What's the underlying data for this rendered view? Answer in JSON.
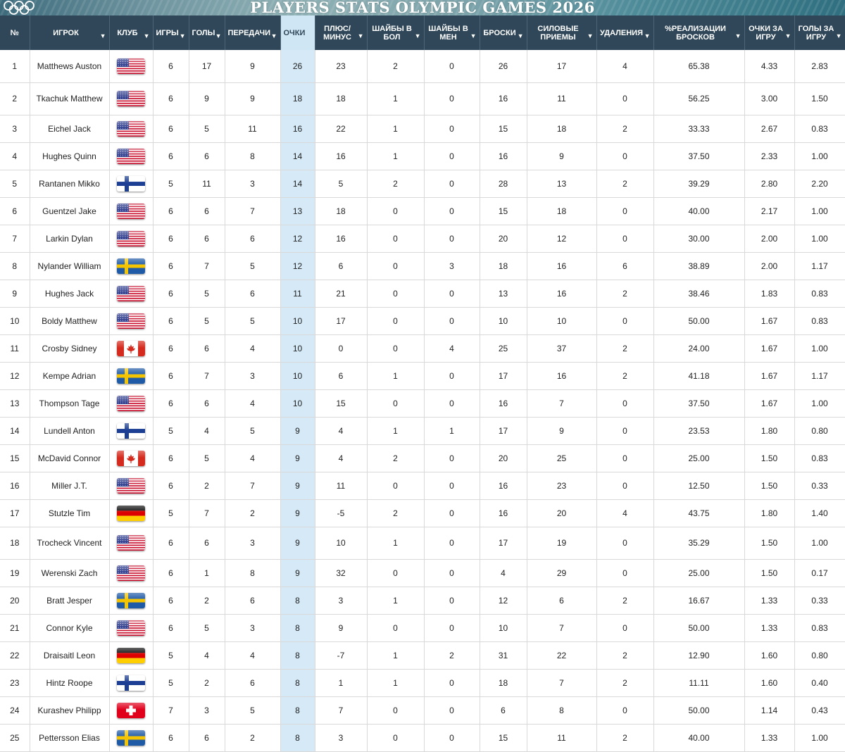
{
  "page": {
    "title": "PLAYERS STATS OLYMPIC GAMES 2026"
  },
  "colors": {
    "header_bg": "#2f4758",
    "highlight_col": "#d5e9f7",
    "highlight_header": "#cfe6f5"
  },
  "columns": [
    {
      "key": "num",
      "label": "№",
      "sortable": false
    },
    {
      "key": "player",
      "label": "ИГРОК",
      "sortable": true
    },
    {
      "key": "club",
      "label": "КЛУБ",
      "sortable": true
    },
    {
      "key": "games",
      "label": "ИГРЫ",
      "sortable": true
    },
    {
      "key": "goals",
      "label": "ГОЛЫ",
      "sortable": true
    },
    {
      "key": "assists",
      "label": "ПЕРЕДАЧИ",
      "sortable": true
    },
    {
      "key": "points",
      "label": "ОЧКИ",
      "sortable": true
    },
    {
      "key": "plusminus",
      "label": "ПЛЮС/ МИНУС",
      "sortable": true
    },
    {
      "key": "ppg",
      "label": "ШАЙБЫ В БОЛ",
      "sortable": true
    },
    {
      "key": "shg",
      "label": "ШАЙБЫ В МЕН",
      "sortable": true
    },
    {
      "key": "shots",
      "label": "БРОСКИ",
      "sortable": true
    },
    {
      "key": "hits",
      "label": "СИЛОВЫЕ ПРИЕМЫ",
      "sortable": true
    },
    {
      "key": "pim",
      "label": "УДАЛЕНИЯ",
      "sortable": true
    },
    {
      "key": "shot_pct",
      "label": "%РЕАЛИЗАЦИИ БРОСКОВ",
      "sortable": true
    },
    {
      "key": "ppg_avg",
      "label": "ОЧКИ ЗА ИГРУ",
      "sortable": true
    },
    {
      "key": "gpg_avg",
      "label": "ГОЛЫ ЗА ИГРУ",
      "sortable": true
    }
  ],
  "rows": [
    {
      "num": "1",
      "player": "Matthews Auston",
      "flag": "usa",
      "games": "6",
      "goals": "17",
      "assists": "9",
      "points": "26",
      "plusminus": "23",
      "ppg": "2",
      "shg": "0",
      "shots": "26",
      "hits": "17",
      "pim": "4",
      "shot_pct": "65.38",
      "ppg_avg": "4.33",
      "gpg_avg": "2.83"
    },
    {
      "num": "2",
      "player": "Tkachuk Matthew",
      "flag": "usa",
      "games": "6",
      "goals": "9",
      "assists": "9",
      "points": "18",
      "plusminus": "18",
      "ppg": "1",
      "shg": "0",
      "shots": "16",
      "hits": "11",
      "pim": "0",
      "shot_pct": "56.25",
      "ppg_avg": "3.00",
      "gpg_avg": "1.50"
    },
    {
      "num": "3",
      "player": "Eichel Jack",
      "flag": "usa",
      "games": "6",
      "goals": "5",
      "assists": "11",
      "points": "16",
      "plusminus": "22",
      "ppg": "1",
      "shg": "0",
      "shots": "15",
      "hits": "18",
      "pim": "2",
      "shot_pct": "33.33",
      "ppg_avg": "2.67",
      "gpg_avg": "0.83"
    },
    {
      "num": "4",
      "player": "Hughes Quinn",
      "flag": "usa",
      "games": "6",
      "goals": "6",
      "assists": "8",
      "points": "14",
      "plusminus": "16",
      "ppg": "1",
      "shg": "0",
      "shots": "16",
      "hits": "9",
      "pim": "0",
      "shot_pct": "37.50",
      "ppg_avg": "2.33",
      "gpg_avg": "1.00"
    },
    {
      "num": "5",
      "player": "Rantanen Mikko",
      "flag": "fin",
      "games": "5",
      "goals": "11",
      "assists": "3",
      "points": "14",
      "plusminus": "5",
      "ppg": "2",
      "shg": "0",
      "shots": "28",
      "hits": "13",
      "pim": "2",
      "shot_pct": "39.29",
      "ppg_avg": "2.80",
      "gpg_avg": "2.20"
    },
    {
      "num": "6",
      "player": "Guentzel Jake",
      "flag": "usa",
      "games": "6",
      "goals": "6",
      "assists": "7",
      "points": "13",
      "plusminus": "18",
      "ppg": "0",
      "shg": "0",
      "shots": "15",
      "hits": "18",
      "pim": "0",
      "shot_pct": "40.00",
      "ppg_avg": "2.17",
      "gpg_avg": "1.00"
    },
    {
      "num": "7",
      "player": "Larkin Dylan",
      "flag": "usa",
      "games": "6",
      "goals": "6",
      "assists": "6",
      "points": "12",
      "plusminus": "16",
      "ppg": "0",
      "shg": "0",
      "shots": "20",
      "hits": "12",
      "pim": "0",
      "shot_pct": "30.00",
      "ppg_avg": "2.00",
      "gpg_avg": "1.00"
    },
    {
      "num": "8",
      "player": "Nylander William",
      "flag": "swe",
      "games": "6",
      "goals": "7",
      "assists": "5",
      "points": "12",
      "plusminus": "6",
      "ppg": "0",
      "shg": "3",
      "shots": "18",
      "hits": "16",
      "pim": "6",
      "shot_pct": "38.89",
      "ppg_avg": "2.00",
      "gpg_avg": "1.17"
    },
    {
      "num": "9",
      "player": "Hughes Jack",
      "flag": "usa",
      "games": "6",
      "goals": "5",
      "assists": "6",
      "points": "11",
      "plusminus": "21",
      "ppg": "0",
      "shg": "0",
      "shots": "13",
      "hits": "16",
      "pim": "2",
      "shot_pct": "38.46",
      "ppg_avg": "1.83",
      "gpg_avg": "0.83"
    },
    {
      "num": "10",
      "player": "Boldy Matthew",
      "flag": "usa",
      "games": "6",
      "goals": "5",
      "assists": "5",
      "points": "10",
      "plusminus": "17",
      "ppg": "0",
      "shg": "0",
      "shots": "10",
      "hits": "10",
      "pim": "0",
      "shot_pct": "50.00",
      "ppg_avg": "1.67",
      "gpg_avg": "0.83"
    },
    {
      "num": "11",
      "player": "Crosby Sidney",
      "flag": "can",
      "games": "6",
      "goals": "6",
      "assists": "4",
      "points": "10",
      "plusminus": "0",
      "ppg": "0",
      "shg": "4",
      "shots": "25",
      "hits": "37",
      "pim": "2",
      "shot_pct": "24.00",
      "ppg_avg": "1.67",
      "gpg_avg": "1.00"
    },
    {
      "num": "12",
      "player": "Kempe Adrian",
      "flag": "swe",
      "games": "6",
      "goals": "7",
      "assists": "3",
      "points": "10",
      "plusminus": "6",
      "ppg": "1",
      "shg": "0",
      "shots": "17",
      "hits": "16",
      "pim": "2",
      "shot_pct": "41.18",
      "ppg_avg": "1.67",
      "gpg_avg": "1.17"
    },
    {
      "num": "13",
      "player": "Thompson Tage",
      "flag": "usa",
      "games": "6",
      "goals": "6",
      "assists": "4",
      "points": "10",
      "plusminus": "15",
      "ppg": "0",
      "shg": "0",
      "shots": "16",
      "hits": "7",
      "pim": "0",
      "shot_pct": "37.50",
      "ppg_avg": "1.67",
      "gpg_avg": "1.00"
    },
    {
      "num": "14",
      "player": "Lundell Anton",
      "flag": "fin",
      "games": "5",
      "goals": "4",
      "assists": "5",
      "points": "9",
      "plusminus": "4",
      "ppg": "1",
      "shg": "1",
      "shots": "17",
      "hits": "9",
      "pim": "0",
      "shot_pct": "23.53",
      "ppg_avg": "1.80",
      "gpg_avg": "0.80"
    },
    {
      "num": "15",
      "player": "McDavid Connor",
      "flag": "can",
      "games": "6",
      "goals": "5",
      "assists": "4",
      "points": "9",
      "plusminus": "4",
      "ppg": "2",
      "shg": "0",
      "shots": "20",
      "hits": "25",
      "pim": "0",
      "shot_pct": "25.00",
      "ppg_avg": "1.50",
      "gpg_avg": "0.83"
    },
    {
      "num": "16",
      "player": "Miller J.T.",
      "flag": "usa",
      "games": "6",
      "goals": "2",
      "assists": "7",
      "points": "9",
      "plusminus": "11",
      "ppg": "0",
      "shg": "0",
      "shots": "16",
      "hits": "23",
      "pim": "0",
      "shot_pct": "12.50",
      "ppg_avg": "1.50",
      "gpg_avg": "0.33"
    },
    {
      "num": "17",
      "player": "Stutzle Tim",
      "flag": "ger",
      "games": "5",
      "goals": "7",
      "assists": "2",
      "points": "9",
      "plusminus": "-5",
      "ppg": "2",
      "shg": "0",
      "shots": "16",
      "hits": "20",
      "pim": "4",
      "shot_pct": "43.75",
      "ppg_avg": "1.80",
      "gpg_avg": "1.40"
    },
    {
      "num": "18",
      "player": "Trocheck Vincent",
      "flag": "usa",
      "games": "6",
      "goals": "6",
      "assists": "3",
      "points": "9",
      "plusminus": "10",
      "ppg": "1",
      "shg": "0",
      "shots": "17",
      "hits": "19",
      "pim": "0",
      "shot_pct": "35.29",
      "ppg_avg": "1.50",
      "gpg_avg": "1.00"
    },
    {
      "num": "19",
      "player": "Werenski Zach",
      "flag": "usa",
      "games": "6",
      "goals": "1",
      "assists": "8",
      "points": "9",
      "plusminus": "32",
      "ppg": "0",
      "shg": "0",
      "shots": "4",
      "hits": "29",
      "pim": "0",
      "shot_pct": "25.00",
      "ppg_avg": "1.50",
      "gpg_avg": "0.17"
    },
    {
      "num": "20",
      "player": "Bratt Jesper",
      "flag": "swe",
      "games": "6",
      "goals": "2",
      "assists": "6",
      "points": "8",
      "plusminus": "3",
      "ppg": "1",
      "shg": "0",
      "shots": "12",
      "hits": "6",
      "pim": "2",
      "shot_pct": "16.67",
      "ppg_avg": "1.33",
      "gpg_avg": "0.33"
    },
    {
      "num": "21",
      "player": "Connor Kyle",
      "flag": "usa",
      "games": "6",
      "goals": "5",
      "assists": "3",
      "points": "8",
      "plusminus": "9",
      "ppg": "0",
      "shg": "0",
      "shots": "10",
      "hits": "7",
      "pim": "0",
      "shot_pct": "50.00",
      "ppg_avg": "1.33",
      "gpg_avg": "0.83"
    },
    {
      "num": "22",
      "player": "Draisaitl Leon",
      "flag": "ger",
      "games": "5",
      "goals": "4",
      "assists": "4",
      "points": "8",
      "plusminus": "-7",
      "ppg": "1",
      "shg": "2",
      "shots": "31",
      "hits": "22",
      "pim": "2",
      "shot_pct": "12.90",
      "ppg_avg": "1.60",
      "gpg_avg": "0.80"
    },
    {
      "num": "23",
      "player": "Hintz Roope",
      "flag": "fin",
      "games": "5",
      "goals": "2",
      "assists": "6",
      "points": "8",
      "plusminus": "1",
      "ppg": "1",
      "shg": "0",
      "shots": "18",
      "hits": "7",
      "pim": "2",
      "shot_pct": "11.11",
      "ppg_avg": "1.60",
      "gpg_avg": "0.40"
    },
    {
      "num": "24",
      "player": "Kurashev Philipp",
      "flag": "sui",
      "games": "7",
      "goals": "3",
      "assists": "5",
      "points": "8",
      "plusminus": "7",
      "ppg": "0",
      "shg": "0",
      "shots": "6",
      "hits": "8",
      "pim": "0",
      "shot_pct": "50.00",
      "ppg_avg": "1.14",
      "gpg_avg": "0.43"
    },
    {
      "num": "25",
      "player": "Pettersson Elias",
      "flag": "swe",
      "games": "6",
      "goals": "6",
      "assists": "2",
      "points": "8",
      "plusminus": "3",
      "ppg": "0",
      "shg": "0",
      "shots": "15",
      "hits": "11",
      "pim": "2",
      "shot_pct": "40.00",
      "ppg_avg": "1.33",
      "gpg_avg": "1.00"
    }
  ]
}
